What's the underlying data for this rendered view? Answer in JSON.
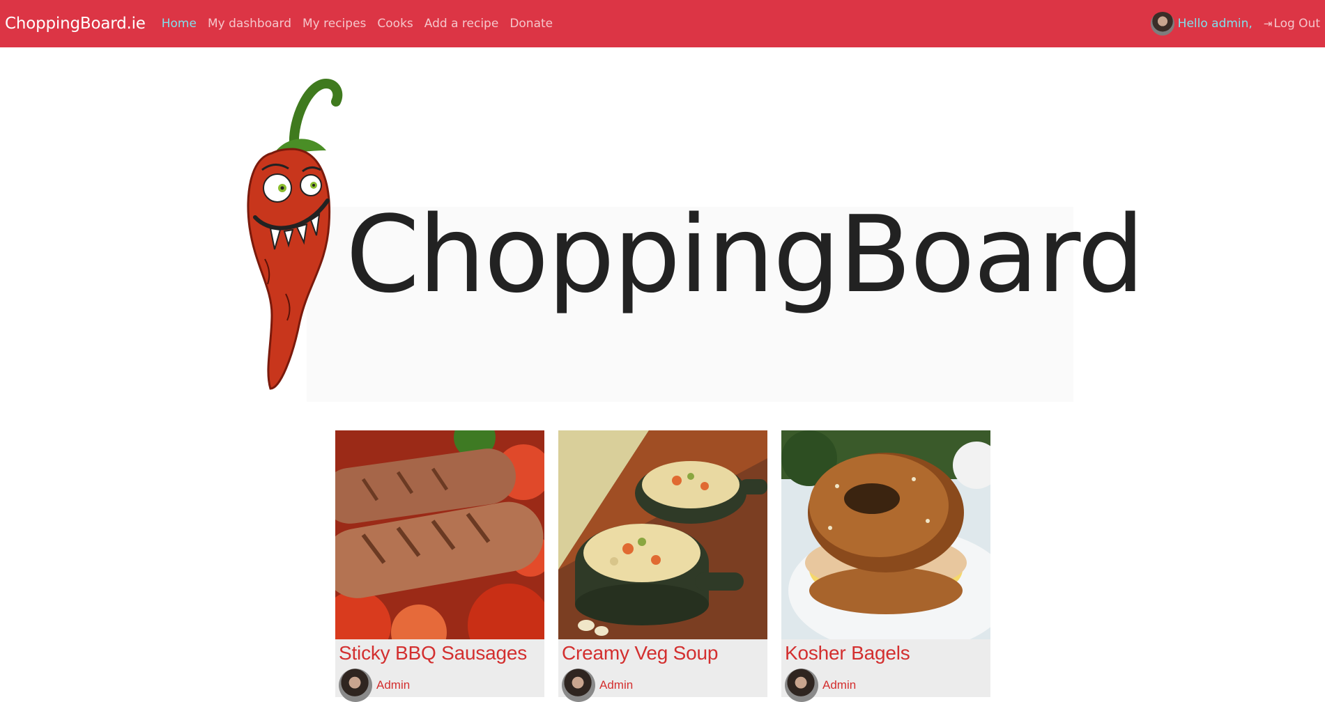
{
  "nav": {
    "brand": "ChoppingBoard.ie",
    "links": [
      "Home",
      "My dashboard",
      "My recipes",
      "Cooks",
      "Add a recipe",
      "Donate"
    ],
    "greeting": "Hello admin,",
    "logout": "Log Out",
    "accent_color": "#dc3545",
    "active_color": "#7fe0ec"
  },
  "hero": {
    "logo_text": "ChoppingBoard"
  },
  "recipes": [
    {
      "title": "Sticky BBQ Sausages",
      "author": "Admin"
    },
    {
      "title": "Creamy Veg Soup",
      "author": "Admin"
    },
    {
      "title": "Kosher Bagels",
      "author": "Admin"
    }
  ]
}
